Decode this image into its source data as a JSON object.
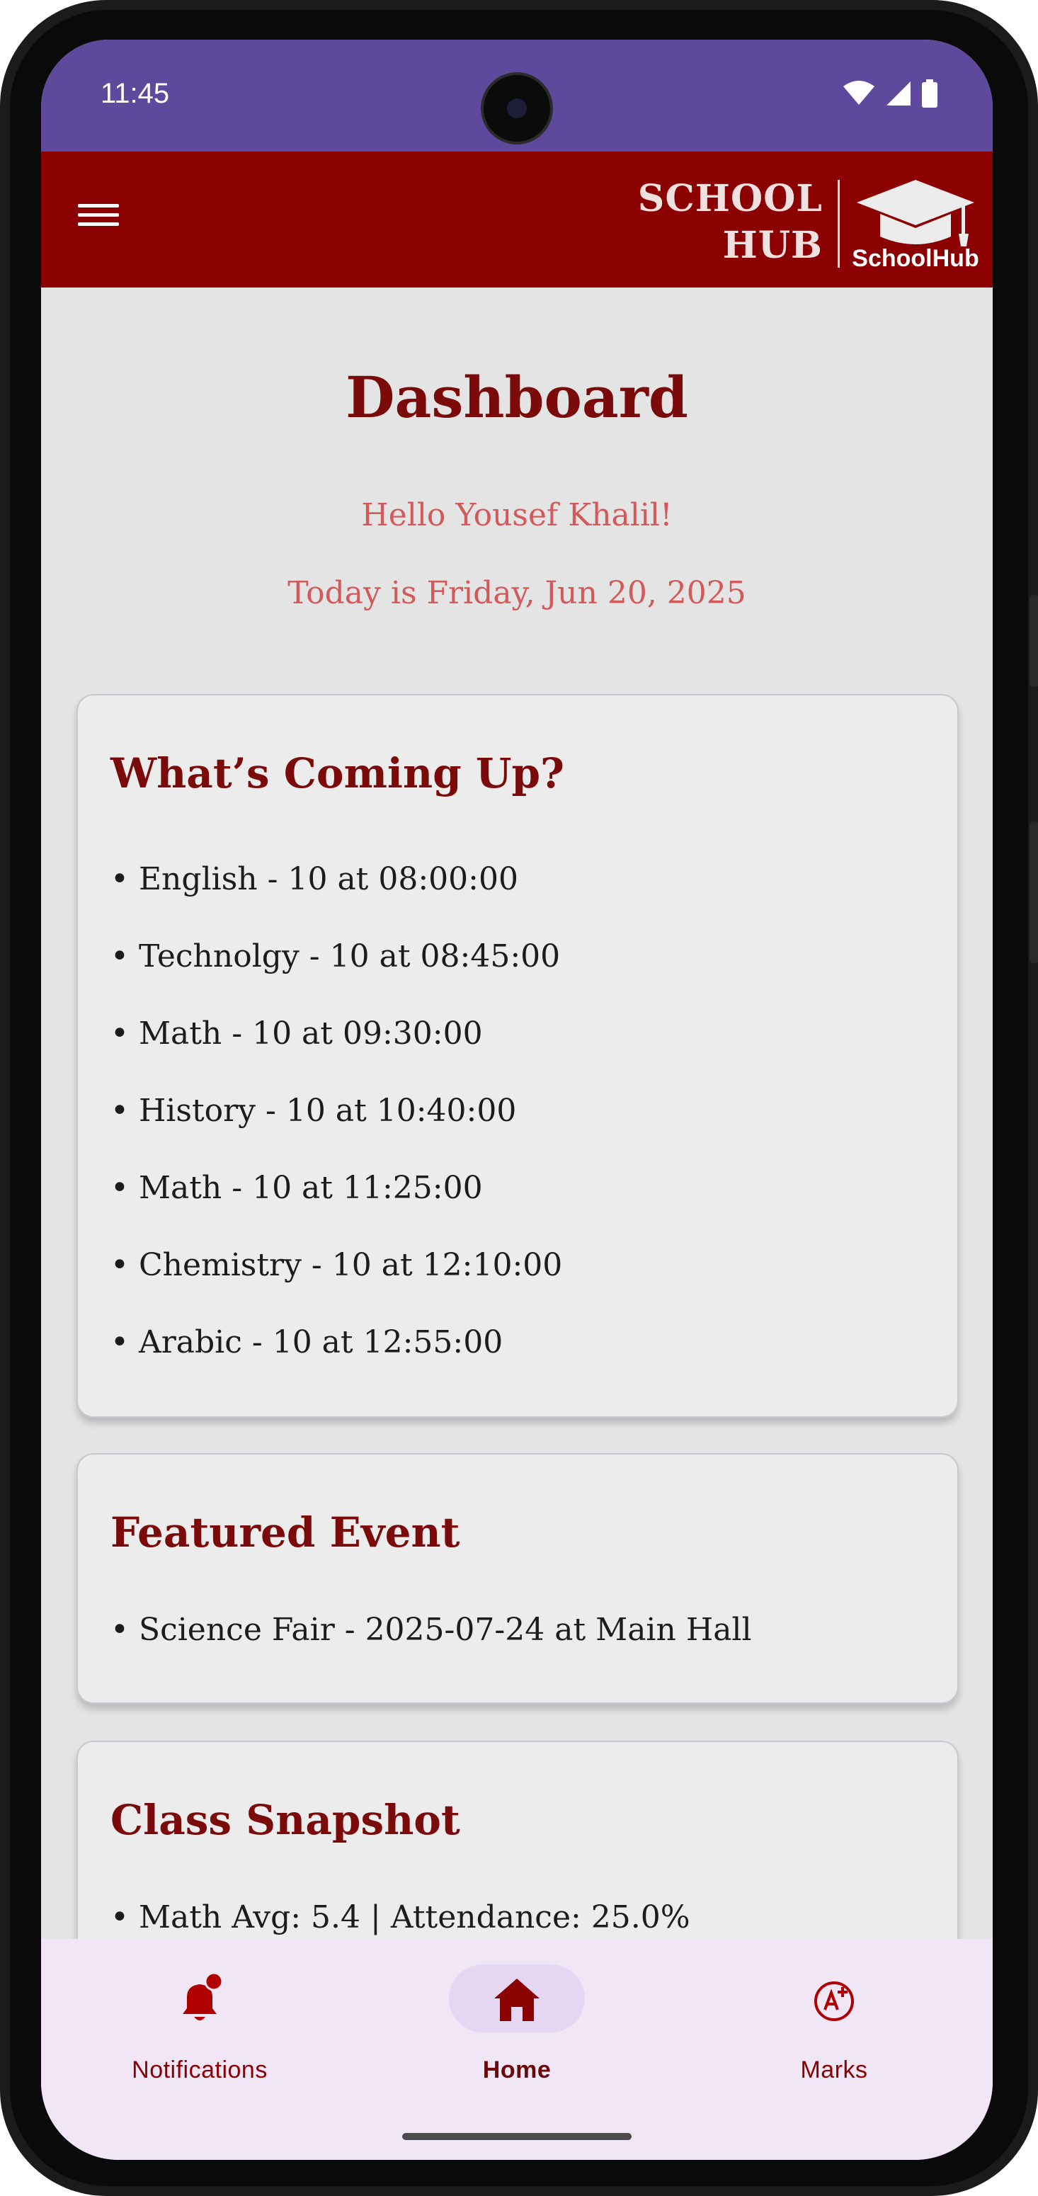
{
  "status_bar": {
    "time": "11:45"
  },
  "app_bar": {
    "brand_line1": "SCHOOL",
    "brand_line2": "HUB",
    "logo_label": "SchoolHub"
  },
  "page": {
    "title": "Dashboard",
    "greeting": "Hello Yousef Khalil!",
    "date_line": "Today is Friday, Jun 20, 2025"
  },
  "cards": {
    "upcoming": {
      "title": "What’s Coming Up?",
      "items": [
        "• English - 10 at 08:00:00",
        "• Technolgy - 10 at 08:45:00",
        "• Math - 10 at 09:30:00",
        "• History - 10 at 10:40:00",
        "• Math - 10 at 11:25:00",
        "• Chemistry - 10 at 12:10:00",
        "• Arabic - 10 at 12:55:00"
      ]
    },
    "featured_event": {
      "title": "Featured Event",
      "items": [
        "• Science Fair - 2025-07-24 at Main Hall"
      ]
    },
    "class_snapshot": {
      "title": "Class Snapshot",
      "items": [
        "• Math Avg: 5.4 | Attendance: 25.0%"
      ]
    }
  },
  "bottom_nav": {
    "items": [
      {
        "label": "Notifications",
        "icon": "bell-badge-icon",
        "active": false
      },
      {
        "label": "Home",
        "icon": "home-icon",
        "active": true
      },
      {
        "label": "Marks",
        "icon": "grade-icon",
        "active": false
      }
    ]
  },
  "colors": {
    "status_bar": "#5d4a9c",
    "app_bar": "#8b0000",
    "title": "#7b0a0a",
    "greeting": "#d25a5a",
    "nav_background": "#f0e6f5",
    "nav_active_pill": "#e5d7f2"
  }
}
